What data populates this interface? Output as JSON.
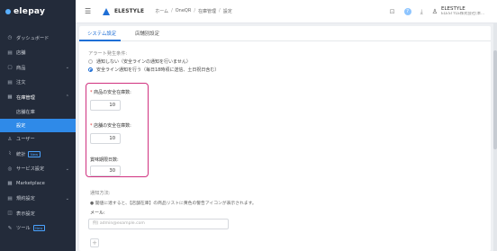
{
  "sidebar": {
    "brand": "elepay",
    "items": [
      {
        "icon": "dashboard-icon",
        "glyph": "◷",
        "label": "ダッシュボード"
      },
      {
        "icon": "store-icon",
        "glyph": "▤",
        "label": "店舗"
      },
      {
        "icon": "product-icon",
        "glyph": "▢",
        "label": "商品",
        "chevron": "⌄"
      },
      {
        "icon": "order-icon",
        "glyph": "▤",
        "label": "注文"
      },
      {
        "icon": "inventory-icon",
        "glyph": "▦",
        "label": "在庫管理",
        "chevron": "⌃"
      },
      {
        "icon": "user-icon",
        "glyph": "♙",
        "label": "ユーザー"
      },
      {
        "icon": "stats-icon",
        "glyph": "⌇",
        "label": "統計",
        "badge": "New"
      },
      {
        "icon": "service-settings-icon",
        "glyph": "◎",
        "label": "サービス設定",
        "chevron": "⌄"
      },
      {
        "icon": "marketplace-icon",
        "glyph": "▦",
        "label": "Marketplace"
      },
      {
        "icon": "rules-icon",
        "glyph": "▤",
        "label": "規約設定",
        "chevron": "⌄"
      },
      {
        "icon": "appearance-icon",
        "glyph": "◫",
        "label": "表示設定"
      },
      {
        "icon": "tools-icon",
        "glyph": "✎",
        "label": "ツール",
        "badge": "New"
      }
    ],
    "sub_items": [
      {
        "label": "店舗在庫"
      },
      {
        "label": "設定"
      }
    ]
  },
  "header": {
    "brand": "ELESTYLE",
    "breadcrumb": [
      "ホーム",
      "OneQR",
      "在庫管理",
      "設定"
    ],
    "user_name": "ELESTYLE",
    "user_company": "ELESTYLE株式会社(本..."
  },
  "tabs": [
    "システム設定",
    "店舗別設定"
  ],
  "alert": {
    "label": "アラート発生条件:",
    "options": [
      "通知しない（安全ラインの通知を行いません）",
      "安全ライン通知を行う（毎日18時頃に送信、土日祝日含む）"
    ],
    "selected_index": 1
  },
  "fields": {
    "product_safety": {
      "label": "商品の安全在庫数:",
      "value": "10"
    },
    "store_safety": {
      "label": "店舗の安全在庫数:",
      "value": "10"
    },
    "expiry_days": {
      "label": "賞味期限日数:",
      "value": "30"
    }
  },
  "notify": {
    "label": "通知方法:",
    "description": "● 閾値に達すると、【店舗在庫】の商品リストに黄色の警告アイコンが表示されます。",
    "email_label": "メール:",
    "email_placeholder": "例) admin@example.com",
    "add_label": "+"
  }
}
